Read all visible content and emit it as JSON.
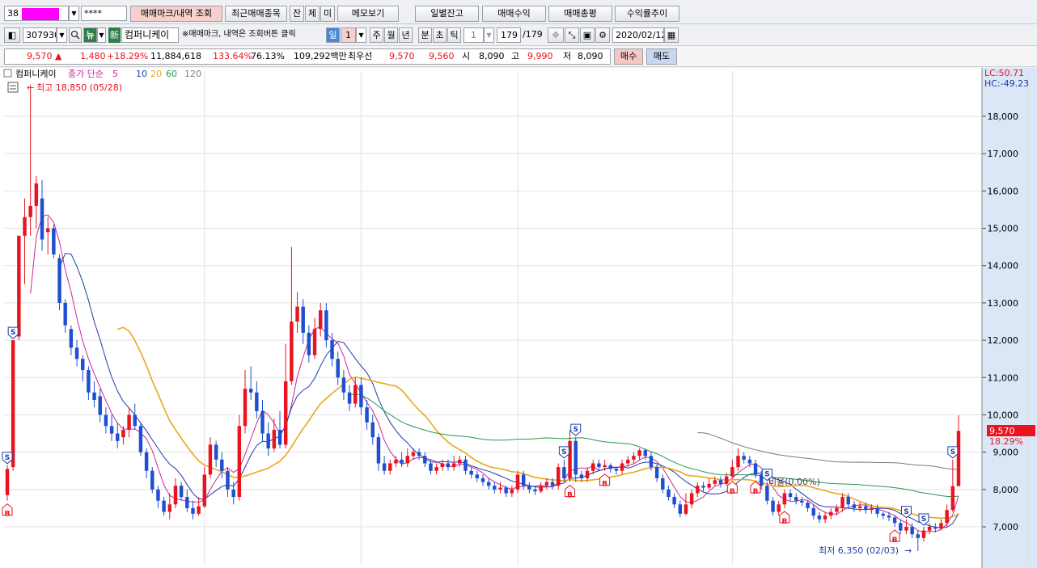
{
  "toolbar1": {
    "code_prefix": "38",
    "password_mask": "****",
    "buttons": [
      "매매마크/내역 조회",
      "최근매매종목",
      "잔",
      "체",
      "미",
      "메모보기",
      "일별잔고",
      "매매수익",
      "매매총평",
      "수익률추이"
    ]
  },
  "toolbar2": {
    "stock_code": "307930",
    "badge_new": "新",
    "stock_name": "컴퍼니케이",
    "hint": "※매매마크, 내역은 조회버튼 클릭",
    "period_labels": [
      "일",
      "주",
      "월",
      "년",
      "분",
      "초",
      "틱"
    ],
    "period_selected": "일",
    "period_value": "1",
    "minute_value": "1",
    "count_value": "179",
    "count_total": "/179",
    "date": "2020/02/12"
  },
  "quote": {
    "price": "9,570",
    "arrow": "▲",
    "change": "1,480",
    "change_pct": "+18.29%",
    "volume": "11,884,618",
    "vol_ratio": "133.64%",
    "turnover": "76.13%",
    "amount": "109,292백만",
    "best_label": "최우선",
    "ask": "9,570",
    "bid": "9,560",
    "open_label": "시",
    "open": "8,090",
    "high_label": "고",
    "high": "9,990",
    "low_label": "저",
    "low": "8,090",
    "buy_label": "매수",
    "sell_label": "매도"
  },
  "chart_header": {
    "name": "컴퍼니케이",
    "ma_title": "종가 단순",
    "ma_periods": [
      "5",
      "10",
      "20",
      "60",
      "120"
    ],
    "ma_colors": [
      "#c8289b",
      "#1e3ca8",
      "#e8a81c",
      "#229a4a",
      "#7a7a7a"
    ],
    "lc": "LC:50.71",
    "hc": "HC:-49.23",
    "price_tag": "9,570",
    "pct_tag": "18.29%",
    "high_marker": "최고 18,850 (05/28)",
    "low_marker": "최저 6,350 (02/03)",
    "mid_note": "비율(0.00%)"
  },
  "chart_data": {
    "type": "candlestick",
    "ylim": [
      6200,
      19200
    ],
    "y_ticks": [
      7000,
      8000,
      9000,
      10000,
      11000,
      12000,
      13000,
      14000,
      15000,
      16000,
      17000,
      18000
    ],
    "y_tick_labels": [
      "7,000",
      "8,000",
      "9,000",
      "10,000",
      "11,000",
      "12,000",
      "13,000",
      "14,000",
      "15,000",
      "16,000",
      "17,000",
      "18,000"
    ],
    "colors": {
      "up": "#e8141f",
      "down": "#1e4fd0"
    },
    "candles": [
      [
        7850,
        8550,
        7700,
        8650
      ],
      [
        8600,
        12000,
        8500,
        12000
      ],
      [
        12100,
        14800,
        12000,
        14800
      ],
      [
        14800,
        15300,
        13500,
        15800
      ],
      [
        15300,
        15600,
        14800,
        18850
      ],
      [
        15600,
        16200,
        15000,
        16400
      ],
      [
        15800,
        14700,
        14400,
        16300
      ],
      [
        14900,
        15000,
        14300,
        15300
      ],
      [
        15000,
        14300,
        14200,
        15100
      ],
      [
        14200,
        13000,
        12800,
        14300
      ],
      [
        13000,
        12400,
        12200,
        13100
      ],
      [
        12300,
        11800,
        11600,
        12400
      ],
      [
        11800,
        11500,
        11300,
        12000
      ],
      [
        11500,
        11200,
        10900,
        11600
      ],
      [
        11200,
        10600,
        10400,
        11300
      ],
      [
        10600,
        10400,
        10200,
        10900
      ],
      [
        10500,
        10000,
        9800,
        10700
      ],
      [
        10000,
        9700,
        9500,
        10200
      ],
      [
        9700,
        9500,
        9300,
        10000
      ],
      [
        9500,
        9300,
        9100,
        9800
      ],
      [
        9400,
        9600,
        9200,
        9700
      ],
      [
        9600,
        10000,
        9400,
        10200
      ],
      [
        10000,
        9700,
        9600,
        10300
      ],
      [
        9700,
        9000,
        8900,
        9800
      ],
      [
        9000,
        8500,
        8300,
        9100
      ],
      [
        8500,
        8000,
        7900,
        8600
      ],
      [
        8000,
        7700,
        7500,
        8100
      ],
      [
        7700,
        7400,
        7300,
        7800
      ],
      [
        7400,
        7600,
        7200,
        7900
      ],
      [
        7600,
        8100,
        7500,
        8300
      ],
      [
        8100,
        7800,
        7700,
        8200
      ],
      [
        7800,
        7500,
        7400,
        8000
      ],
      [
        7500,
        7350,
        7200,
        7700
      ],
      [
        7350,
        7550,
        7300,
        7800
      ],
      [
        7550,
        8400,
        7500,
        8600
      ],
      [
        8400,
        9200,
        8300,
        9400
      ],
      [
        9200,
        8800,
        8600,
        9300
      ],
      [
        8800,
        8500,
        8300,
        9000
      ],
      [
        8500,
        8000,
        7800,
        8600
      ],
      [
        8000,
        7800,
        7600,
        8200
      ],
      [
        7800,
        9700,
        7700,
        10000
      ],
      [
        9700,
        10700,
        9500,
        11200
      ],
      [
        10700,
        10600,
        10400,
        11300
      ],
      [
        10600,
        10100,
        9900,
        10900
      ],
      [
        10100,
        9500,
        9300,
        10400
      ],
      [
        9500,
        9100,
        8900,
        9800
      ],
      [
        9100,
        9600,
        9000,
        9900
      ],
      [
        9600,
        9200,
        9100,
        10100
      ],
      [
        9200,
        10900,
        9100,
        11900
      ],
      [
        10900,
        12500,
        10800,
        14500
      ],
      [
        12500,
        12900,
        12200,
        13300
      ],
      [
        12900,
        12200,
        11900,
        13100
      ],
      [
        12200,
        11600,
        11400,
        12400
      ],
      [
        11600,
        12300,
        11500,
        12600
      ],
      [
        12300,
        12800,
        12100,
        13000
      ],
      [
        12800,
        12000,
        11800,
        13000
      ],
      [
        12000,
        11500,
        11300,
        12200
      ],
      [
        11500,
        11000,
        10800,
        11700
      ],
      [
        11000,
        10600,
        10400,
        11200
      ],
      [
        10600,
        10300,
        10100,
        10800
      ],
      [
        10300,
        10800,
        10200,
        11000
      ],
      [
        10800,
        10200,
        10000,
        11000
      ],
      [
        10200,
        9800,
        9600,
        10400
      ],
      [
        9800,
        9400,
        9200,
        10000
      ],
      [
        9400,
        8700,
        8500,
        9500
      ],
      [
        8700,
        8500,
        8400,
        8900
      ],
      [
        8500,
        8700,
        8400,
        8800
      ],
      [
        8700,
        8800,
        8600,
        8900
      ],
      [
        8800,
        8700,
        8600,
        9000
      ],
      [
        8700,
        8900,
        8600,
        9100
      ],
      [
        8900,
        9000,
        8800,
        9100
      ],
      [
        9000,
        8900,
        8800,
        9100
      ],
      [
        8900,
        8700,
        8600,
        9000
      ],
      [
        8700,
        8500,
        8400,
        8800
      ],
      [
        8500,
        8600,
        8400,
        8700
      ],
      [
        8600,
        8700,
        8500,
        8800
      ],
      [
        8700,
        8600,
        8500,
        8800
      ],
      [
        8600,
        8700,
        8500,
        8900
      ],
      [
        8700,
        8800,
        8600,
        8900
      ],
      [
        8800,
        8500,
        8400,
        8900
      ],
      [
        8500,
        8400,
        8300,
        8600
      ],
      [
        8400,
        8300,
        8200,
        8500
      ],
      [
        8300,
        8200,
        8100,
        8400
      ],
      [
        8200,
        8100,
        8000,
        8300
      ],
      [
        8100,
        8000,
        7900,
        8200
      ],
      [
        8000,
        8050,
        7900,
        8200
      ],
      [
        8050,
        7900,
        7800,
        8100
      ],
      [
        7900,
        8000,
        7800,
        8100
      ],
      [
        8000,
        8400,
        7900,
        8500
      ],
      [
        8400,
        8100,
        8000,
        8500
      ],
      [
        8100,
        8000,
        7900,
        8200
      ],
      [
        8000,
        7950,
        7850,
        8100
      ],
      [
        7950,
        8100,
        7900,
        8200
      ],
      [
        8100,
        8200,
        8000,
        8300
      ],
      [
        8200,
        8100,
        8000,
        8300
      ],
      [
        8100,
        8600,
        8000,
        8700
      ],
      [
        8600,
        8300,
        8200,
        8800
      ],
      [
        8300,
        9300,
        8200,
        9600
      ],
      [
        9300,
        8400,
        8200,
        9400
      ],
      [
        8400,
        8300,
        8200,
        8500
      ],
      [
        8300,
        8500,
        8200,
        8600
      ],
      [
        8500,
        8700,
        8400,
        8800
      ],
      [
        8700,
        8600,
        8500,
        8800
      ],
      [
        8600,
        8650,
        8500,
        8800
      ],
      [
        8650,
        8550,
        8450,
        8700
      ],
      [
        8550,
        8500,
        8400,
        8600
      ],
      [
        8500,
        8700,
        8400,
        8800
      ],
      [
        8700,
        8800,
        8600,
        8900
      ],
      [
        8800,
        8900,
        8700,
        9000
      ],
      [
        8900,
        9050,
        8800,
        9100
      ],
      [
        9050,
        8900,
        8800,
        9100
      ],
      [
        8900,
        8600,
        8500,
        9000
      ],
      [
        8600,
        8300,
        8200,
        8700
      ],
      [
        8300,
        8000,
        7900,
        8400
      ],
      [
        8000,
        7800,
        7700,
        8100
      ],
      [
        7800,
        7600,
        7500,
        7900
      ],
      [
        7600,
        7350,
        7250,
        7700
      ],
      [
        7350,
        7600,
        7300,
        7900
      ],
      [
        7600,
        7900,
        7500,
        8000
      ],
      [
        7900,
        8100,
        7800,
        8200
      ],
      [
        8100,
        8050,
        7950,
        8200
      ],
      [
        8050,
        8150,
        8000,
        8300
      ],
      [
        8150,
        8250,
        8100,
        8350
      ],
      [
        8250,
        8150,
        8050,
        8350
      ],
      [
        8150,
        8350,
        8100,
        8450
      ],
      [
        8350,
        8600,
        8300,
        8800
      ],
      [
        8600,
        8900,
        8500,
        9100
      ],
      [
        8900,
        8800,
        8700,
        9000
      ],
      [
        8800,
        8700,
        8600,
        8900
      ],
      [
        8700,
        8400,
        8300,
        8800
      ],
      [
        8400,
        8100,
        8000,
        8500
      ],
      [
        8100,
        7700,
        7600,
        8200
      ],
      [
        7700,
        7400,
        7300,
        7800
      ],
      [
        7400,
        7600,
        7300,
        7700
      ],
      [
        7600,
        7900,
        7500,
        8000
      ],
      [
        7900,
        7800,
        7700,
        8000
      ],
      [
        7800,
        7700,
        7600,
        7900
      ],
      [
        7700,
        7650,
        7550,
        7800
      ],
      [
        7650,
        7500,
        7400,
        7700
      ],
      [
        7500,
        7300,
        7200,
        7600
      ],
      [
        7300,
        7200,
        7100,
        7400
      ],
      [
        7200,
        7300,
        7100,
        7400
      ],
      [
        7300,
        7400,
        7200,
        7500
      ],
      [
        7400,
        7500,
        7300,
        7600
      ],
      [
        7500,
        7800,
        7400,
        7900
      ],
      [
        7800,
        7600,
        7500,
        7900
      ],
      [
        7600,
        7500,
        7400,
        7700
      ],
      [
        7500,
        7550,
        7400,
        7650
      ],
      [
        7550,
        7450,
        7350,
        7650
      ],
      [
        7450,
        7500,
        7350,
        7600
      ],
      [
        7500,
        7350,
        7250,
        7600
      ],
      [
        7350,
        7300,
        7200,
        7400
      ],
      [
        7300,
        7250,
        7150,
        7400
      ],
      [
        7250,
        7100,
        7000,
        7300
      ],
      [
        7100,
        6900,
        6800,
        7200
      ],
      [
        6900,
        7000,
        6800,
        7200
      ],
      [
        7000,
        6800,
        6700,
        7100
      ],
      [
        6800,
        6700,
        6350,
        6900
      ],
      [
        6700,
        6900,
        6600,
        7000
      ],
      [
        6900,
        7000,
        6800,
        7100
      ],
      [
        7000,
        6950,
        6850,
        7100
      ],
      [
        6950,
        7100,
        6900,
        7200
      ],
      [
        7100,
        7450,
        7000,
        7600
      ],
      [
        7450,
        8090,
        7400,
        8800
      ],
      [
        8090,
        9570,
        8090,
        9990
      ]
    ],
    "signals": [
      {
        "i": 0,
        "type": "B",
        "at": "low"
      },
      {
        "i": 1,
        "type": "S",
        "at": "high"
      },
      {
        "i": 0,
        "type": "S",
        "at": "high"
      },
      {
        "i": 96,
        "type": "S",
        "at": "high"
      },
      {
        "i": 97,
        "type": "B",
        "at": "low"
      },
      {
        "i": 98,
        "type": "S",
        "at": "high"
      },
      {
        "i": 103,
        "type": "B",
        "at": "low"
      },
      {
        "i": 125,
        "type": "B",
        "at": "low"
      },
      {
        "i": 129,
        "type": "B",
        "at": "low"
      },
      {
        "i": 131,
        "type": "S",
        "at": "high"
      },
      {
        "i": 153,
        "type": "B",
        "at": "low"
      },
      {
        "i": 155,
        "type": "S",
        "at": "high"
      },
      {
        "i": 134,
        "type": "B",
        "at": "low"
      },
      {
        "i": 158,
        "type": "S",
        "at": "high"
      },
      {
        "i": 163,
        "type": "S",
        "at": "high"
      }
    ]
  }
}
